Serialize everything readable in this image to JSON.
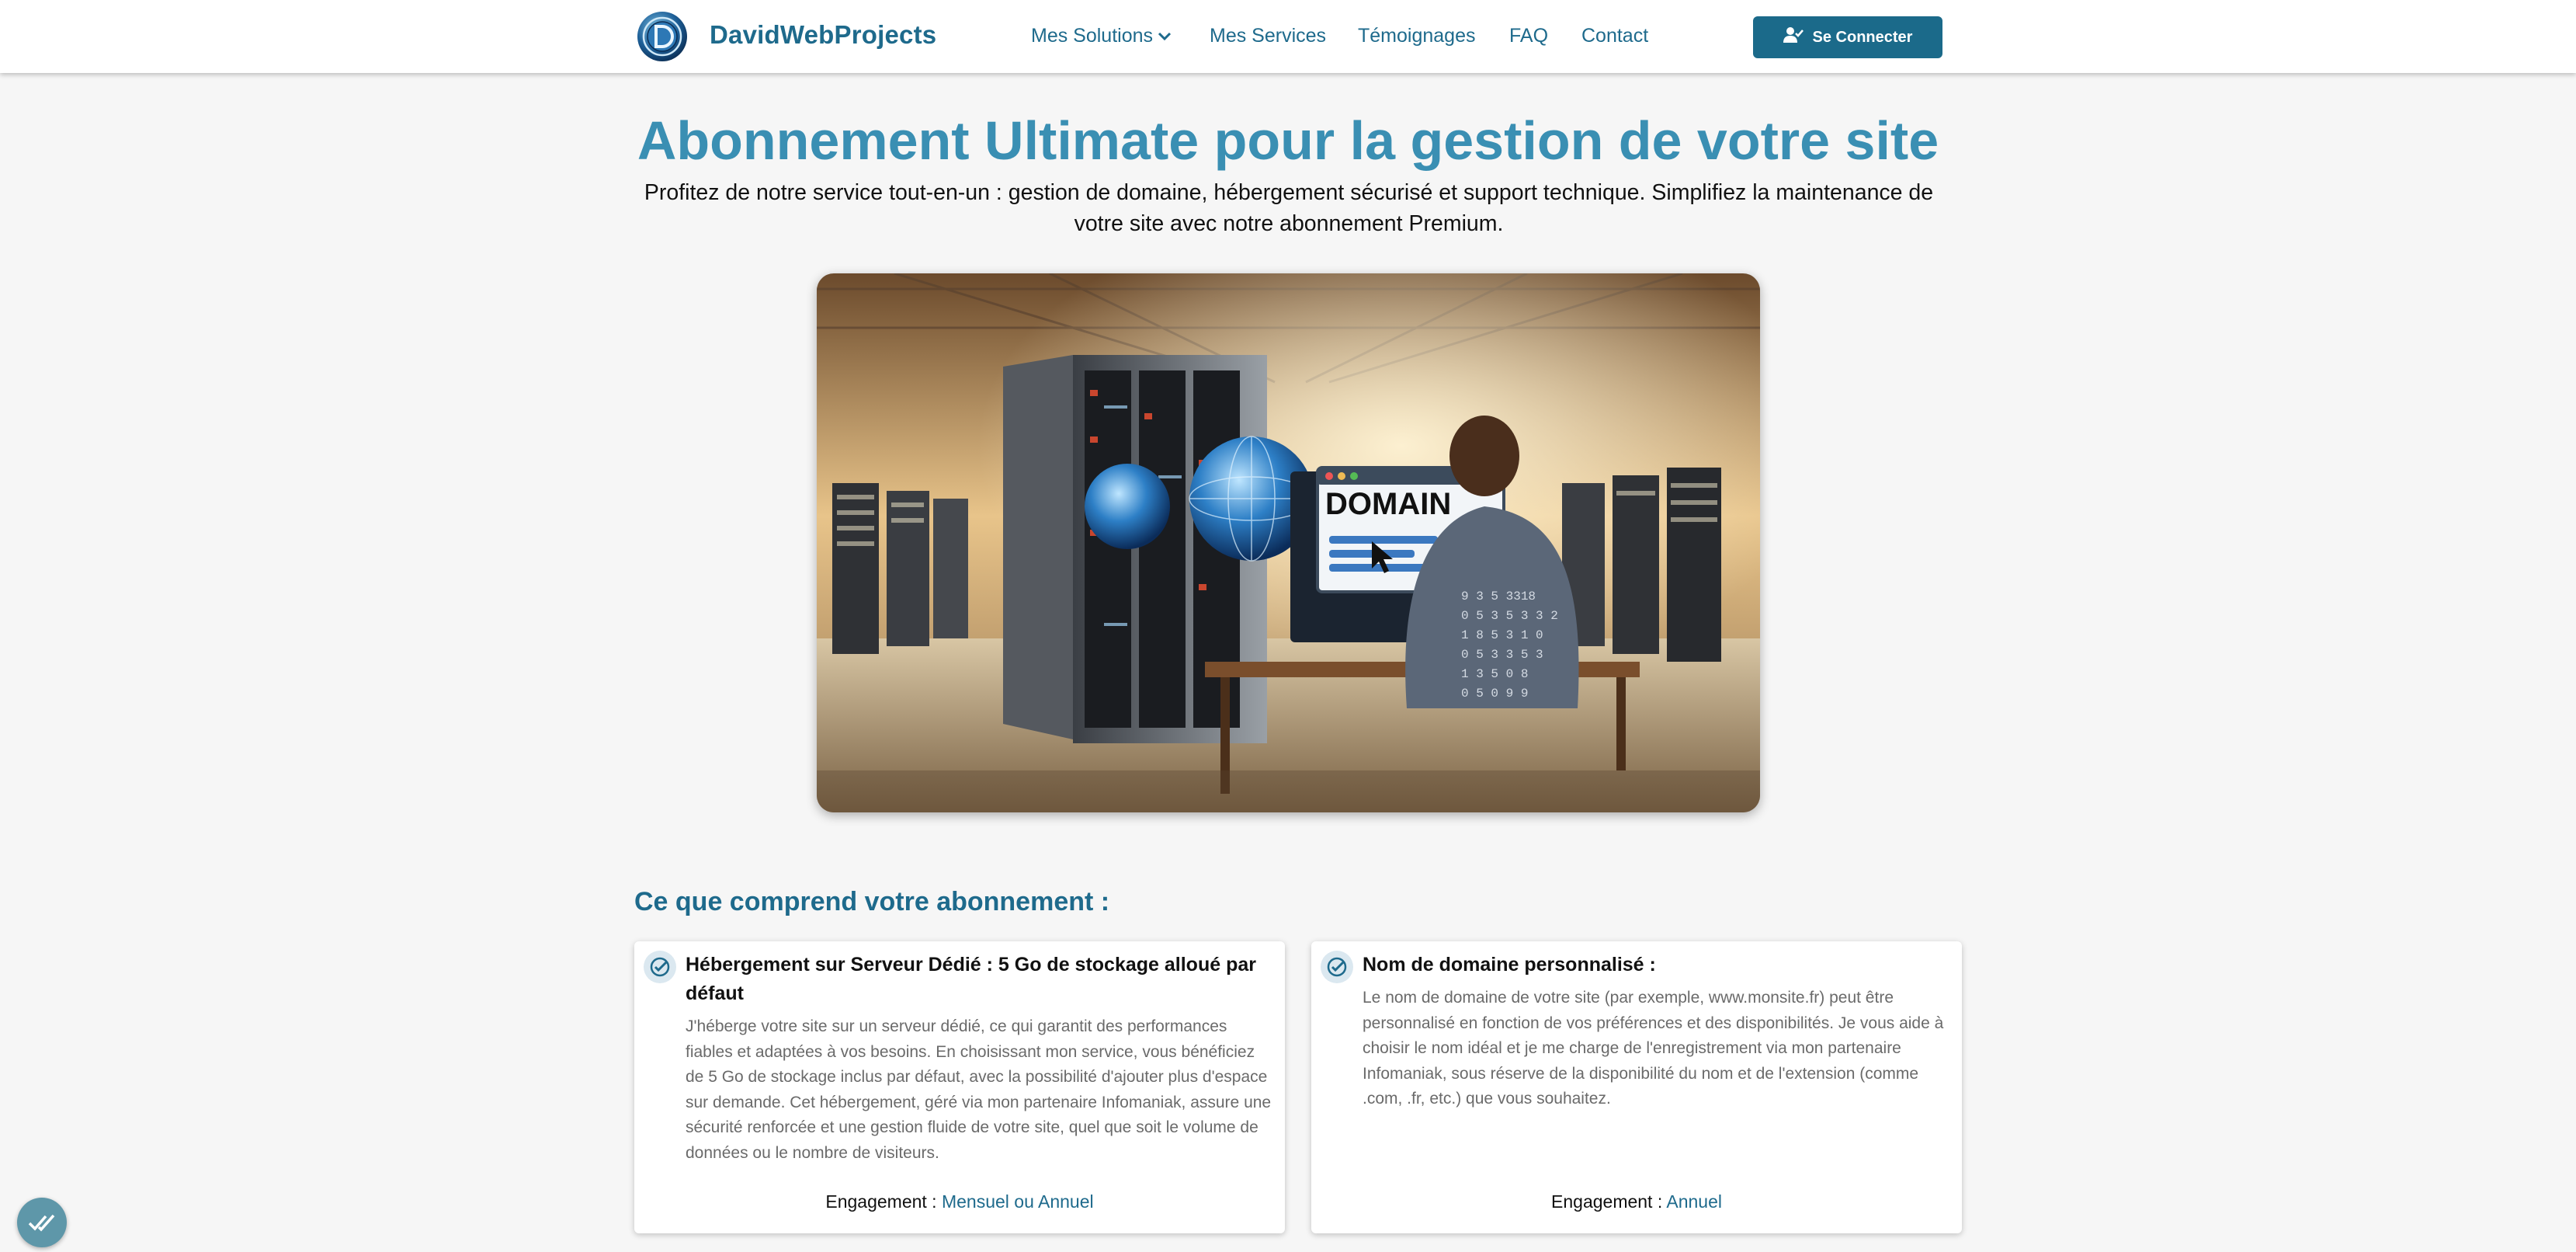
{
  "header": {
    "brand": "DavidWebProjects",
    "nav": [
      {
        "label": "Mes Solutions"
      },
      {
        "label": "Mes Services"
      },
      {
        "label": "Témoignages"
      },
      {
        "label": "FAQ"
      },
      {
        "label": "Contact"
      }
    ],
    "login_label": "Se Connecter"
  },
  "hero": {
    "title": "Abonnement Ultimate pour la gestion de votre site",
    "subtitle": "Profitez de notre service tout-en-un : gestion de domaine, hébergement sécurisé et support technique. Simplifiez la maintenance de votre site avec notre abonnement Premium.",
    "image_text": "DOMAIN"
  },
  "section": {
    "title": "Ce que comprend votre abonnement :",
    "cards": [
      {
        "title": "Hébergement sur Serveur Dédié : 5 Go de stockage alloué par défaut",
        "text": "J'héberge votre site sur un serveur dédié, ce qui garantit des performances fiables et adaptées à vos besoins. En choisissant mon service, vous bénéficiez de 5 Go de stockage inclus par défaut, avec la possibilité d'ajouter plus d'espace sur demande. Cet hébergement, géré via mon partenaire Infomaniak, assure une sécurité renforcée et une gestion fluide de votre site, quel que soit le volume de données ou le nombre de visiteurs.",
        "engagement_label": "Engagement :",
        "engagement_value": "Mensuel ou Annuel"
      },
      {
        "title": "Nom de domaine personnalisé :",
        "text": "Le nom de domaine de votre site (par exemple, www.monsite.fr) peut être personnalisé en fonction de vos préférences et des disponibilités. Je vous aide à choisir le nom idéal et je me charge de l'enregistrement via mon partenaire Infomaniak, sous réserve de la disponibilité du nom et de l'extension (comme .com, .fr, etc.) que vous souhaitez.",
        "engagement_label": "Engagement :",
        "engagement_value": "Annuel"
      }
    ]
  },
  "colors": {
    "brand": "#1e6a8c",
    "title": "#3a8fb3",
    "button": "#1b6a8a",
    "background": "#f6f6f6"
  },
  "icons": [
    "logo-d-icon",
    "chevron-down-icon",
    "user-check-icon",
    "check-circle-icon",
    "double-check-icon"
  ]
}
